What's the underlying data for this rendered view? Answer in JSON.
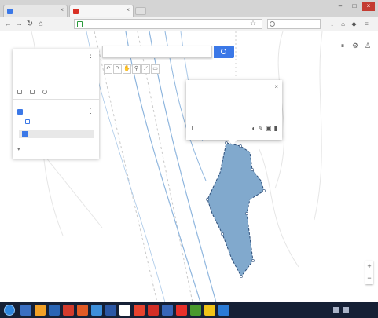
{
  "browser": {
    "tabs": [
      {
        "title": "",
        "favicon_color": "#3b78e7"
      },
      {
        "title": "",
        "favicon_color": "#d93025"
      }
    ],
    "address": "",
    "search_placeholder": ""
  },
  "map": {
    "search_placeholder": "",
    "drawing_tools": [
      "undo-icon",
      "redo-icon",
      "hand-icon",
      "marker-icon",
      "line-icon",
      "ruler-icon"
    ],
    "layer_panel": {
      "title": "",
      "subtitle": "",
      "meta": "",
      "actions": [
        {
          "label": "",
          "icon": "add-layer-icon"
        },
        {
          "label": "",
          "icon": "share-icon"
        },
        {
          "label": "",
          "icon": "preview-icon"
        }
      ],
      "layer_name": "",
      "style_label": "",
      "feature_name": "",
      "basemap_label": ""
    },
    "info_window": {
      "title": "",
      "body": "",
      "footer_label": ""
    },
    "place_label": "",
    "logo": "",
    "credits": "",
    "colors": {
      "polygon_fill": "#6b9ac4",
      "polygon_stroke": "#2e4f7a",
      "water": "#8fb6de",
      "accent": "#3b78e7"
    }
  },
  "taskbar": {
    "clock": ""
  }
}
